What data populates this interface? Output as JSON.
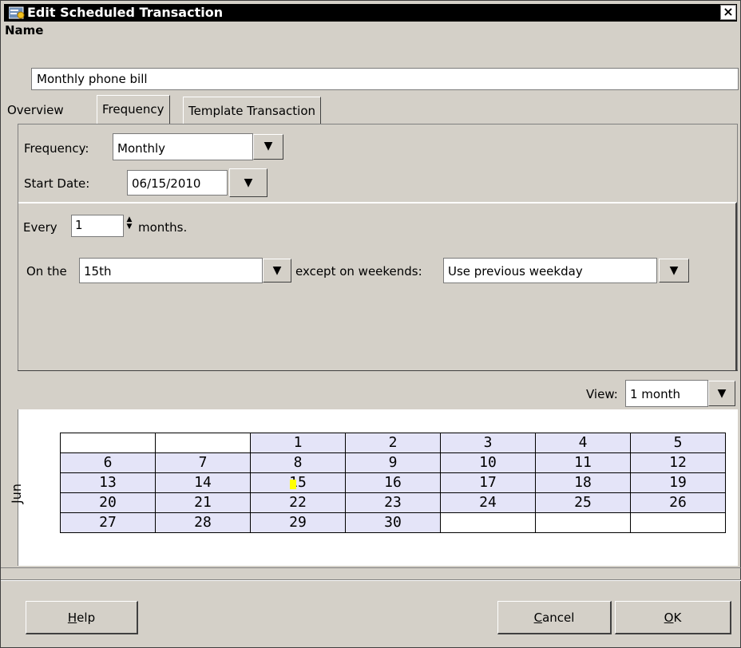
{
  "window": {
    "title": "Edit Scheduled Transaction",
    "close_glyph": "×"
  },
  "name": {
    "label": "Name",
    "value": "Monthly phone bill"
  },
  "tabs": [
    {
      "label": "Overview"
    },
    {
      "label": "Frequency"
    },
    {
      "label": "Template Transaction"
    }
  ],
  "frequency": {
    "label": "Frequency:",
    "value": "Monthly",
    "start_label": "Start Date:",
    "start_value": "06/15/2010",
    "every_label": "Every",
    "every_value": "1",
    "every_unit": "months.",
    "on_the_label": "On the",
    "on_the_value": "15th",
    "except_label": "except on weekends:",
    "except_value": "Use previous weekday"
  },
  "view": {
    "label": "View:",
    "value": "1 month"
  },
  "calendar": {
    "month": "Jun",
    "weeks": [
      [
        "",
        "",
        "1",
        "2",
        "3",
        "4",
        "5"
      ],
      [
        "6",
        "7",
        "8",
        "9",
        "10",
        "11",
        "12"
      ],
      [
        "13",
        "14",
        "15",
        "16",
        "17",
        "18",
        "19"
      ],
      [
        "20",
        "21",
        "22",
        "23",
        "24",
        "25",
        "26"
      ],
      [
        "27",
        "28",
        "29",
        "30",
        "",
        "",
        ""
      ]
    ],
    "highlighted_day": "15",
    "in_month_color": "#e4e4f8",
    "mark_color": "#ffff00"
  },
  "buttons": {
    "help_mnemonic": "H",
    "help_rest": "elp",
    "cancel_mnemonic": "C",
    "cancel_rest": "ancel",
    "ok_mnemonic": "O",
    "ok_rest": "K"
  }
}
